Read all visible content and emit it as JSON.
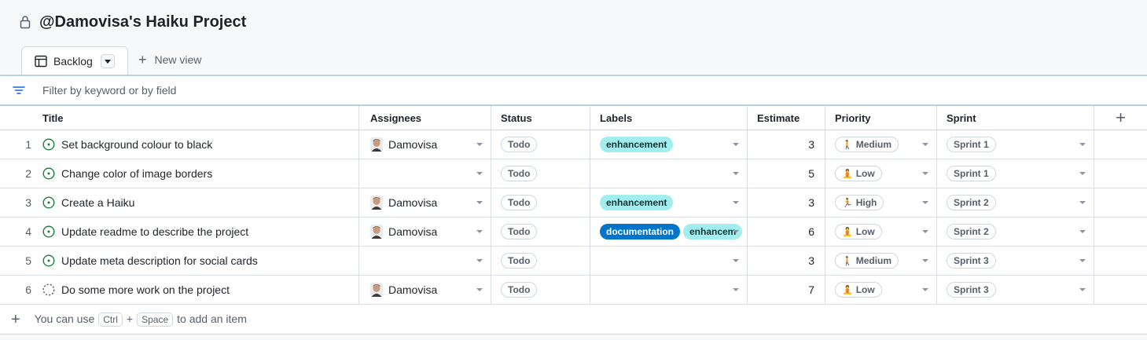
{
  "project": {
    "title": "@Damovisa's Haiku Project"
  },
  "tabs": {
    "active_label": "Backlog",
    "new_view_label": "New view"
  },
  "filter": {
    "placeholder": "Filter by keyword or by field"
  },
  "columns": {
    "title": "Title",
    "assignees": "Assignees",
    "status": "Status",
    "labels": "Labels",
    "estimate": "Estimate",
    "priority": "Priority",
    "sprint": "Sprint"
  },
  "rows": [
    {
      "num": "1",
      "state": "open",
      "title": "Set background colour to black",
      "assignee": "Damovisa",
      "status": "Todo",
      "labels": [
        {
          "text": "enhancement",
          "kind": "enhancement"
        }
      ],
      "estimate": "3",
      "priority": "Medium",
      "priority_icon": "walking-person-icon",
      "sprint": "Sprint 1"
    },
    {
      "num": "2",
      "state": "open",
      "title": "Change color of image borders",
      "assignee": "",
      "status": "Todo",
      "labels": [],
      "estimate": "5",
      "priority": "Low",
      "priority_icon": "meditating-person-icon",
      "sprint": "Sprint 1"
    },
    {
      "num": "3",
      "state": "open",
      "title": "Create a Haiku",
      "assignee": "Damovisa",
      "status": "Todo",
      "labels": [
        {
          "text": "enhancement",
          "kind": "enhancement"
        }
      ],
      "estimate": "3",
      "priority": "High",
      "priority_icon": "running-person-icon",
      "sprint": "Sprint 2"
    },
    {
      "num": "4",
      "state": "open",
      "title": "Update readme to describe the project",
      "assignee": "Damovisa",
      "status": "Todo",
      "labels": [
        {
          "text": "documentation",
          "kind": "documentation"
        },
        {
          "text": "enhancem",
          "kind": "enhancement"
        }
      ],
      "estimate": "6",
      "priority": "Low",
      "priority_icon": "meditating-person-icon",
      "sprint": "Sprint 2"
    },
    {
      "num": "5",
      "state": "open",
      "title": "Update meta description for social cards",
      "assignee": "",
      "status": "Todo",
      "labels": [],
      "estimate": "3",
      "priority": "Medium",
      "priority_icon": "walking-person-icon",
      "sprint": "Sprint 3"
    },
    {
      "num": "6",
      "state": "draft",
      "title": "Do some more work on the project",
      "assignee": "Damovisa",
      "status": "Todo",
      "labels": [],
      "estimate": "7",
      "priority": "Low",
      "priority_icon": "meditating-person-icon",
      "sprint": "Sprint 3"
    }
  ],
  "footer": {
    "prefix": "You can use",
    "key1": "Ctrl",
    "plus": "+",
    "key2": "Space",
    "suffix": "to add an item"
  },
  "colors": {
    "enhancement_bg": "#a2eeef",
    "enhancement_fg": "#0b3536",
    "documentation_bg": "#0075ca",
    "documentation_fg": "#ffffff",
    "open_issue": "#1a7f37",
    "draft_issue": "#57606a"
  }
}
